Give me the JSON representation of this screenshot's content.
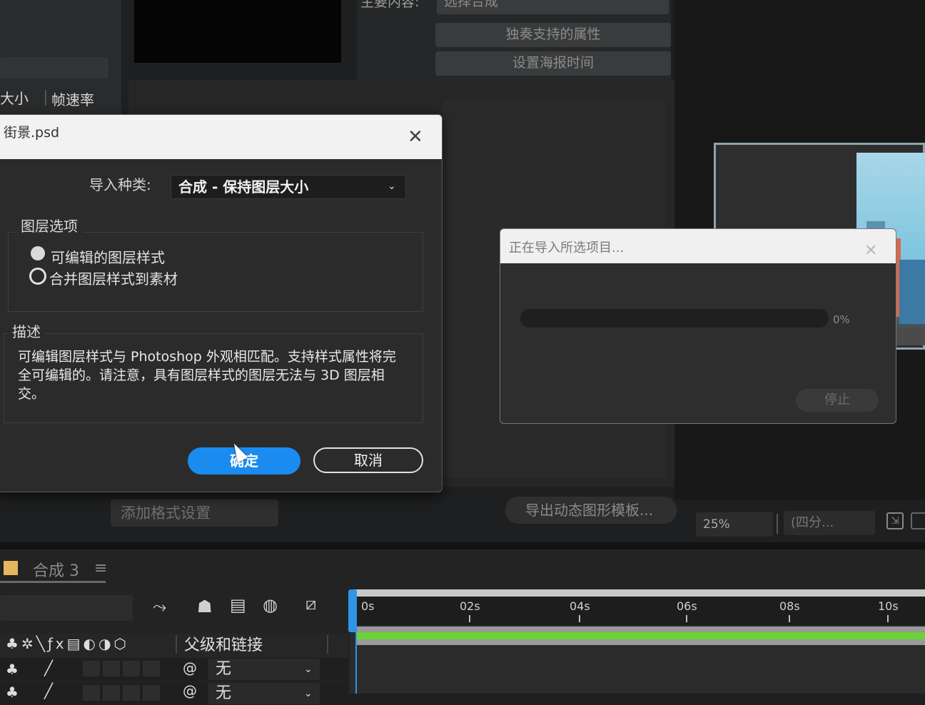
{
  "background": {
    "project_columns": {
      "size": "大小",
      "fps": "帧速率"
    },
    "essential_graphics": {
      "main_label": "主要内容:",
      "choose_comp": "选择合成",
      "solo_props": "独奏支持的属性",
      "set_poster_time": "设置海报时间",
      "add_format": "添加格式设置",
      "export_template": "导出动态图形模板..."
    },
    "viewer": {
      "zoom": "25%",
      "resolution": "(四分..."
    }
  },
  "timeline": {
    "tab_label": "合成 3",
    "menu_icon": "≡",
    "ruler_labels": [
      "0s",
      "02s",
      "04s",
      "06s",
      "08s",
      "10s"
    ],
    "column_icons": "♣✲╲ƒx▤◐◑⬡",
    "parent_label": "父级和链接",
    "rows": [
      {
        "parent": "无"
      },
      {
        "parent": "无"
      }
    ]
  },
  "psd_dialog": {
    "title": "街景.psd",
    "import_kind_label": "导入种类:",
    "import_kind_value": "合成 - 保持图层大小",
    "layer_options_label": "图层选项",
    "option_editable": "可编辑的图层样式",
    "option_merge": "合并图层样式到素材",
    "selected_option": "merge",
    "description_label": "描述",
    "description": "可编辑图层样式与 Photoshop 外观相匹配。支持样式属性将完全可编辑的。请注意，具有图层样式的图层无法与 3D 图层相交。",
    "ok_label": "确定",
    "cancel_label": "取消"
  },
  "progress_dialog": {
    "title": "正在导入所选项目...",
    "percent_label": "0%",
    "progress": 0,
    "stop_label": "停止"
  },
  "colors": {
    "accent_blue": "#1a8cf0",
    "track_green": "#69d234",
    "comp_tab_icon": "#e6b75f"
  }
}
